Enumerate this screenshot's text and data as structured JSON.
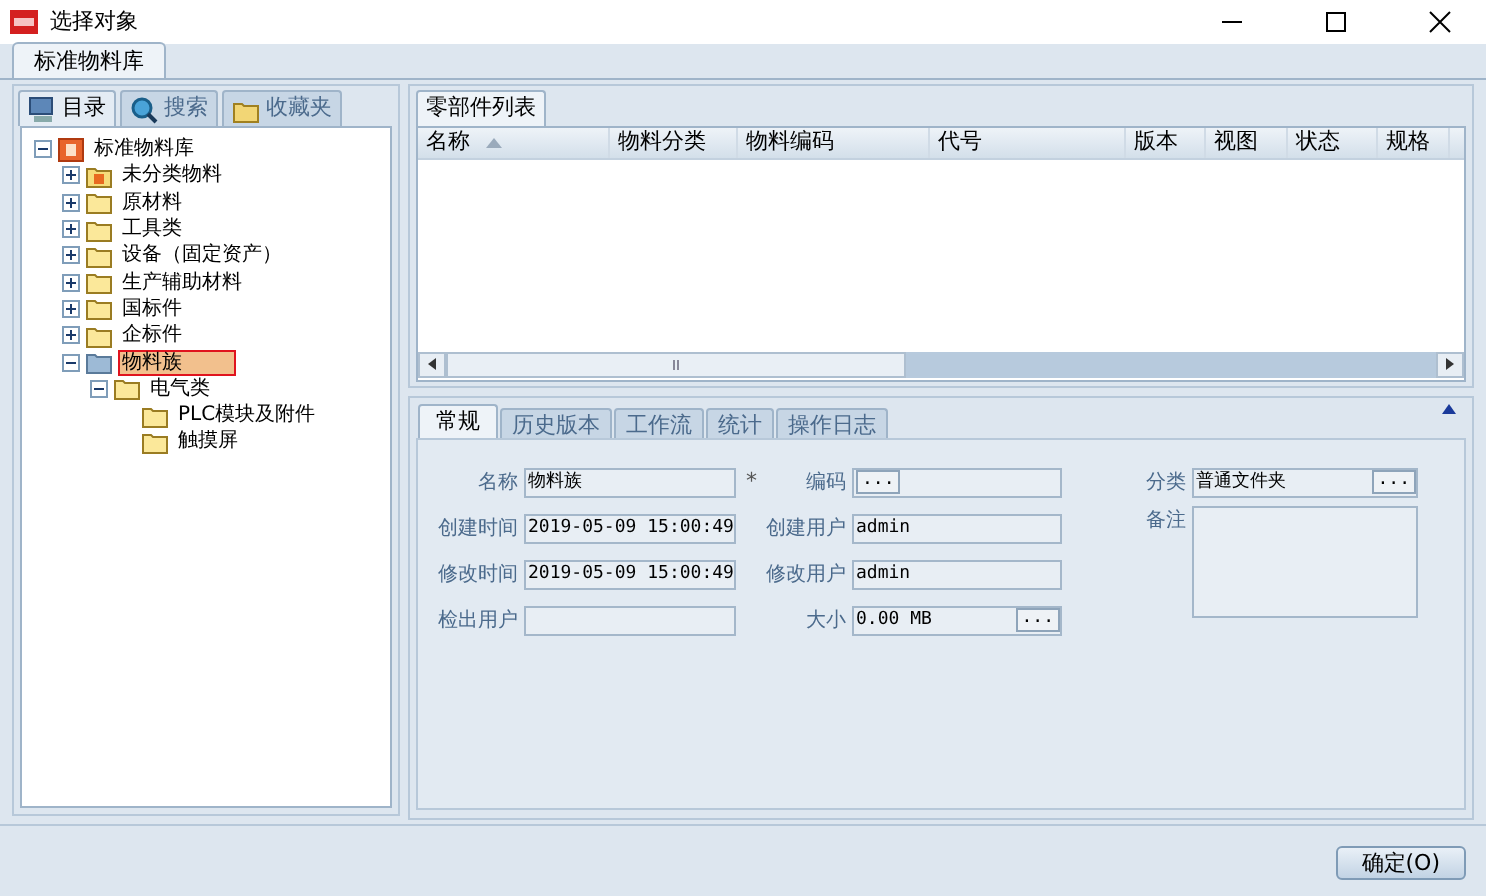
{
  "window": {
    "title": "选择对象"
  },
  "library_tabs": [
    {
      "label": "标准物料库",
      "selected": true
    }
  ],
  "side_tabs": [
    {
      "label": "目录",
      "kind": "catalog",
      "selected": true
    },
    {
      "label": "搜索",
      "kind": "search",
      "selected": false
    },
    {
      "label": "收藏夹",
      "kind": "favorites",
      "selected": false
    }
  ],
  "tree": [
    {
      "label": "标准物料库",
      "kind": "library",
      "expanded": true,
      "selected": false,
      "children": [
        {
          "label": "未分类物料",
          "kind": "special",
          "expanded": false,
          "selected": false
        },
        {
          "label": "原材料",
          "kind": "folder",
          "expanded": false,
          "selected": false
        },
        {
          "label": "工具类",
          "kind": "folder",
          "expanded": false,
          "selected": false
        },
        {
          "label": "设备（固定资产）",
          "kind": "folder",
          "expanded": false,
          "selected": false
        },
        {
          "label": "生产辅助材料",
          "kind": "folder",
          "expanded": false,
          "selected": false
        },
        {
          "label": "国标件",
          "kind": "folder",
          "expanded": false,
          "selected": false
        },
        {
          "label": "企标件",
          "kind": "folder",
          "expanded": false,
          "selected": false
        },
        {
          "label": "物料族",
          "kind": "folder",
          "expanded": true,
          "selected": true,
          "children": [
            {
              "label": "电气类",
              "kind": "folder",
              "expanded": true,
              "selected": false,
              "children": [
                {
                  "label": "PLC模块及附件",
                  "kind": "folder",
                  "selected": false
                },
                {
                  "label": "触摸屏",
                  "kind": "folder",
                  "selected": false
                }
              ]
            }
          ]
        }
      ]
    }
  ],
  "parts_panel": {
    "title": "零部件列表",
    "columns": [
      {
        "label": "名称",
        "sorted": true
      },
      {
        "label": "物料分类",
        "sorted": false
      },
      {
        "label": "物料编码",
        "sorted": false
      },
      {
        "label": "代号",
        "sorted": false
      },
      {
        "label": "版本",
        "sorted": false
      },
      {
        "label": "视图",
        "sorted": false
      },
      {
        "label": "状态",
        "sorted": false
      },
      {
        "label": "规格",
        "sorted": false
      }
    ]
  },
  "detail_tabs": [
    {
      "label": "常规",
      "selected": true
    },
    {
      "label": "历史版本",
      "selected": false
    },
    {
      "label": "工作流",
      "selected": false
    },
    {
      "label": "统计",
      "selected": false
    },
    {
      "label": "操作日志",
      "selected": false
    }
  ],
  "fields": [
    {
      "label": "名称",
      "value": "物料族",
      "kind": "text",
      "required": true,
      "browse": false
    },
    {
      "label": "编码",
      "kind": "text",
      "required": false,
      "browse": true
    },
    {
      "label": "分类",
      "value": "普通文件夹",
      "kind": "text",
      "required": false,
      "browse": true
    },
    {
      "label": "创建时间",
      "value": "2019-05-09 15:00:49",
      "kind": "text",
      "required": false,
      "browse": false
    },
    {
      "label": "创建用户",
      "value": "admin",
      "kind": "text",
      "required": false,
      "browse": false
    },
    {
      "label": "备注",
      "kind": "textarea",
      "required": false,
      "browse": false
    },
    {
      "label": "修改时间",
      "value": "2019-05-09 15:00:49",
      "kind": "text",
      "required": false,
      "browse": false
    },
    {
      "label": "修改用户",
      "value": "admin",
      "kind": "text",
      "required": false,
      "browse": false
    },
    {
      "label": "检出用户",
      "kind": "text",
      "required": false,
      "browse": false
    },
    {
      "label": "大小",
      "value": "0.00 MB",
      "kind": "text",
      "required": false,
      "browse": true
    }
  ],
  "browse_label": "...",
  "required_mark": "*",
  "buttons": [
    {
      "label": "确定(O)"
    }
  ]
}
